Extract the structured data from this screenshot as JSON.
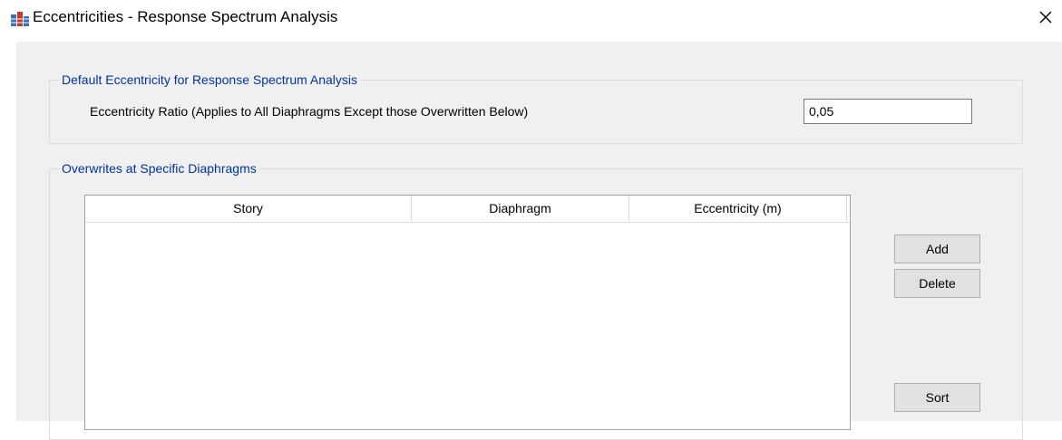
{
  "window": {
    "title": "Eccentricities - Response Spectrum Analysis",
    "icon": "building-frame-icon",
    "close_icon": "close-icon"
  },
  "default_group": {
    "legend": "Default Eccentricity for Response Spectrum Analysis",
    "ratio_label": "Eccentricity Ratio (Applies to All Diaphragms Except those Overwritten Below)",
    "ratio_value": "0,05"
  },
  "overwrites_group": {
    "legend": "Overwrites at Specific Diaphragms",
    "columns": [
      "Story",
      "Diaphragm",
      "Eccentricity (m)"
    ],
    "rows": [],
    "buttons": {
      "add": "Add",
      "delete": "Delete",
      "sort": "Sort"
    }
  },
  "colors": {
    "dialog_background": "#f0f0f0",
    "group_legend_text": "#0033a0",
    "button_face": "#e1e1e1"
  }
}
